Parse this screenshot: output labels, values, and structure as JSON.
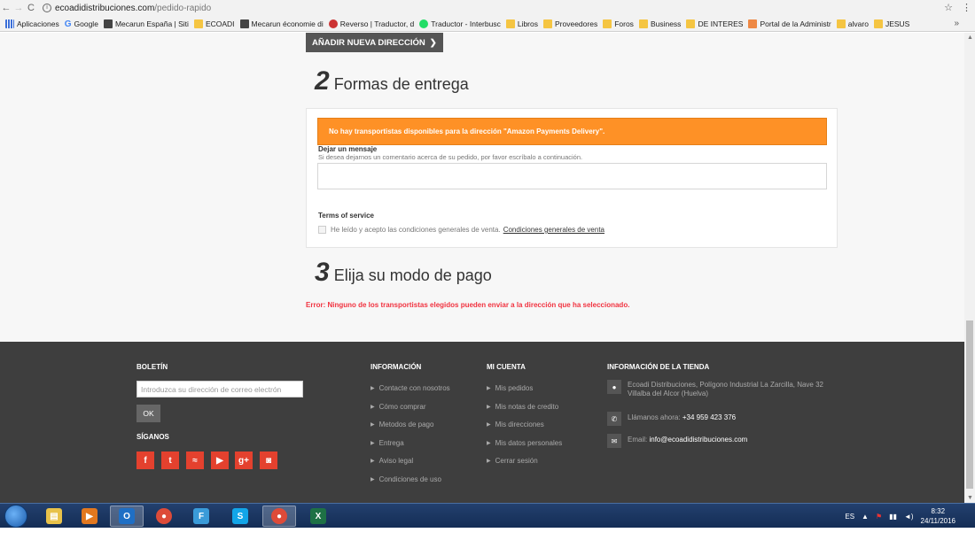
{
  "browser": {
    "back": "←",
    "forward": "→",
    "reload": "C",
    "url_domain": "ecoadidistribuciones.com",
    "url_path": "/pedido-rapido",
    "star": "☆",
    "menu": "⋮",
    "bookmarks": [
      {
        "label": "Aplicaciones",
        "icon": "apps"
      },
      {
        "label": "Google",
        "icon": "google"
      },
      {
        "label": "Mecarun España | Siti",
        "icon": "page"
      },
      {
        "label": "ECOADI",
        "icon": "folder"
      },
      {
        "label": "Mecarun économie di",
        "icon": "page"
      },
      {
        "label": "Reverso | Traductor, d",
        "icon": "reverso"
      },
      {
        "label": "Traductor - Interbusc",
        "icon": "translator"
      },
      {
        "label": "Libros",
        "icon": "folder"
      },
      {
        "label": "Proveedores",
        "icon": "folder"
      },
      {
        "label": "Foros",
        "icon": "folder"
      },
      {
        "label": "Business",
        "icon": "folder"
      },
      {
        "label": "DE INTERES",
        "icon": "folder"
      },
      {
        "label": "Portal de la Administr",
        "icon": "admin"
      },
      {
        "label": "alvaro",
        "icon": "folder"
      },
      {
        "label": "JESUS",
        "icon": "folder"
      }
    ],
    "bookmarks_more": "»"
  },
  "checkout": {
    "add_address_button": "AÑADIR NUEVA DIRECCIÓN",
    "step2_number": "2",
    "step2_title": "Formas de entrega",
    "carrier_alert": "No hay transportistas disponibles para la dirección \"Amazon Payments Delivery\".",
    "message_label": "Dejar un mensaje",
    "message_hint": "Si desea dejarnos un comentario acerca de su pedido, por favor escríbalo a continuación.",
    "terms_title": "Terms of service",
    "terms_text": "He leído y acepto las condiciones generales de venta.",
    "terms_link": "Condiciones generales de venta",
    "step3_number": "3",
    "step3_title": "Elija su modo de pago",
    "payment_error": "Error: Ninguno de los transportistas elegidos pueden enviar a la dirección que ha seleccionado."
  },
  "footer": {
    "newsletter_title": "BOLETÍN",
    "newsletter_placeholder": "Introduzca su dirección de correo electrón",
    "ok_button": "OK",
    "follow_title": "SÍGANOS",
    "social": [
      {
        "name": "facebook",
        "glyph": "f"
      },
      {
        "name": "twitter",
        "glyph": "t"
      },
      {
        "name": "rss",
        "glyph": "≈"
      },
      {
        "name": "youtube",
        "glyph": "▶"
      },
      {
        "name": "google-plus",
        "glyph": "g+"
      },
      {
        "name": "instagram",
        "glyph": "◙"
      }
    ],
    "info_title": "INFORMACIÓN",
    "info_links": [
      "Contacte con nosotros",
      "Cómo comprar",
      "Metodos de pago",
      "Entrega",
      "Aviso legal",
      "Condiciones de uso"
    ],
    "account_title": "MI CUENTA",
    "account_links": [
      "Mis pedidos",
      "Mis notas de credito",
      "Mis direcciones",
      "Mis datos personales",
      "Cerrar sesión"
    ],
    "store_title": "INFORMACIÓN DE LA TIENDA",
    "store_address": "Ecoadi Distribuciones, Polígono Industrial La Zarcilla, Nave 32 Villalba del Alcor (Huelva)",
    "store_phone_label": "Llámanos ahora:",
    "store_phone": "+34 959 423 376",
    "store_email_label": "Email:",
    "store_email": "info@ecoadidistribuciones.com"
  },
  "taskbar": {
    "apps": [
      {
        "name": "explorer",
        "glyph": "▤",
        "color": "#e8c24a"
      },
      {
        "name": "media-player",
        "glyph": "▶",
        "color": "#e2781f"
      },
      {
        "name": "outlook",
        "glyph": "O",
        "color": "#1f6fc5"
      },
      {
        "name": "chrome",
        "glyph": "●",
        "color": "#dd4b39"
      },
      {
        "name": "filezilla",
        "glyph": "F",
        "color": "#3a9bd9"
      },
      {
        "name": "skype",
        "glyph": "S",
        "color": "#12a5e8"
      },
      {
        "name": "chrome-active",
        "glyph": "●",
        "color": "#dd4b39"
      },
      {
        "name": "excel",
        "glyph": "X",
        "color": "#1e7145"
      }
    ],
    "language": "ES",
    "time": "8:32",
    "date": "24/11/2016"
  }
}
